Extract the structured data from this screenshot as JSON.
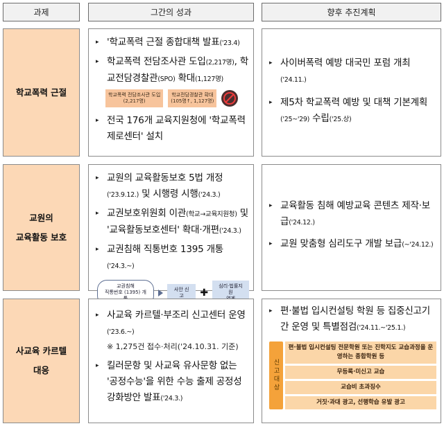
{
  "headers": {
    "topic": "과제",
    "results": "그간의 성과",
    "plans": "향후 추진계획"
  },
  "rows": [
    {
      "topic": "학교폭력 근절",
      "results": [
        {
          "text": "'학교폭력 근절 종합대책 발표",
          "small": "('23.4)"
        },
        {
          "text": "학교폭력 전담조사관 도입",
          "small": "(2,217명)",
          "text2": ", 학교전담경찰관",
          "small2": "(SPO)",
          "text3": " 확대",
          "small3": "(1,127명)"
        },
        {
          "text": "전국 176개 교육지원청에 '학교폭력제로센터' 설치"
        }
      ],
      "badges": [
        {
          "line1": "학교폭력 전담조사관 도입",
          "line2": "(2,217명)"
        },
        {
          "line1": "학교전담경찰관 확대",
          "line2": "(105명↑, 1,127명)"
        }
      ],
      "badge_icon": "no-violence-icon",
      "plans": [
        {
          "text": "사이버폭력 예방 대국민 포럼 개최",
          "small": "('24.11.)"
        },
        {
          "text": "제5차 학교폭력 예방 및 대책 기본계획",
          "small": "('25~'29)",
          "text2": " 수립",
          "small2": "('25.상)"
        }
      ]
    },
    {
      "topic_line1": "교원의",
      "topic_line2": "교육활동 보호",
      "results": [
        {
          "text": "교원의 교육활동보호 5법 개정",
          "small": "('23.9.12.)",
          "text2": " 및 시행령 시행",
          "small2": "('24.3.)"
        },
        {
          "text": "교권보호위원회 이관",
          "small": "(학교→교육지원청)",
          "text2": " 및 '교육활동보호센터' 확대·개편",
          "small2": "('24.3.)"
        },
        {
          "text": "교권침해 직통번호 1395 개통",
          "small": "('24.3.~)"
        }
      ],
      "flow": {
        "pill_line1": "교권침해",
        "pill_line2": "직통번호 (1395) 개통",
        "box1": "사안 신고",
        "plus": "✚",
        "box2_line1": "심리·법률지원",
        "box2_line2": "연계"
      },
      "plans": [
        {
          "text": "교육활동 침해 예방교육 콘텐츠 제작·보급",
          "small": "('24.12.)"
        },
        {
          "text": "교원 맞춤형 심리도구 개발 보급",
          "small": "(~'24.12.)"
        }
      ]
    },
    {
      "topic_line1": "사교육 카르텔",
      "topic_line2": "대응",
      "results": [
        {
          "text": "사교육 카르텔·부조리 신고센터 운영",
          "small": "('23.6.~)"
        },
        {
          "text": "킬러문항 및 사교육 유사문항 없는 '공정수능'을 위한 수능 출제 공정성 강화방안 발표",
          "small": "('24.3.)"
        }
      ],
      "note": "※ 1,275건 접수·처리('24.10.31. 기준)",
      "plans": [
        {
          "text": "편·불법 입시컨설팅 학원 등 집중신고기간 운영 및 특별점검",
          "small": "('24.11.~'25.1.)"
        }
      ],
      "scope_label": "신고대상",
      "scope_items": [
        "편·불법 입시컨설팅 전문학원 또는 진학지도 교습과정을 운영하는 종합학원 등",
        "무등록·미신고 교습",
        "교습비 초과징수",
        "거짓·과대 광고, 선행학습 유발 광고"
      ]
    }
  ],
  "bullet": "▸"
}
